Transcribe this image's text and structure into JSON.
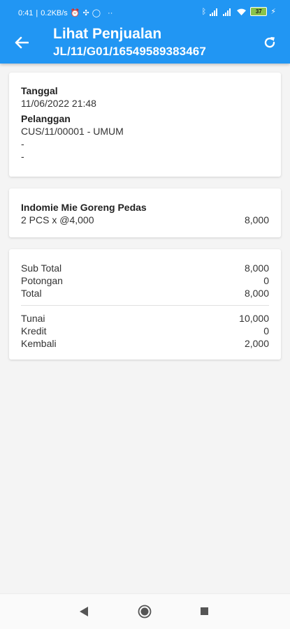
{
  "status_bar": {
    "time": "0:41",
    "speed": "0.2KB/s"
  },
  "app_bar": {
    "title": "Lihat Penjualan",
    "subtitle": "JL/11/G01/16549589383467",
    "back_icon": "arrow-left-icon",
    "refresh_icon": "refresh-icon",
    "color": "#2196f3"
  },
  "info": {
    "date_label": "Tanggal",
    "date_value": "11/06/2022 21:48",
    "customer_label": "Pelanggan",
    "customer_value": "CUS/11/00001 - UMUM",
    "extra1": "-",
    "extra2": "-"
  },
  "items": [
    {
      "name": "Indomie Mie Goreng Pedas",
      "qty_price": "2 PCS x @4,000",
      "subtotal": "8,000"
    }
  ],
  "summary": {
    "sub_total_label": "Sub Total",
    "sub_total_value": "8,000",
    "discount_label": "Potongan",
    "discount_value": "0",
    "total_label": "Total",
    "total_value": "8,000",
    "cash_label": "Tunai",
    "cash_value": "10,000",
    "credit_label": "Kredit",
    "credit_value": "0",
    "change_label": "Kembali",
    "change_value": "2,000"
  },
  "nav_bar": {
    "back_icon": "triangle-back-icon",
    "home_icon": "circle-home-icon",
    "recent_icon": "square-recents-icon"
  }
}
